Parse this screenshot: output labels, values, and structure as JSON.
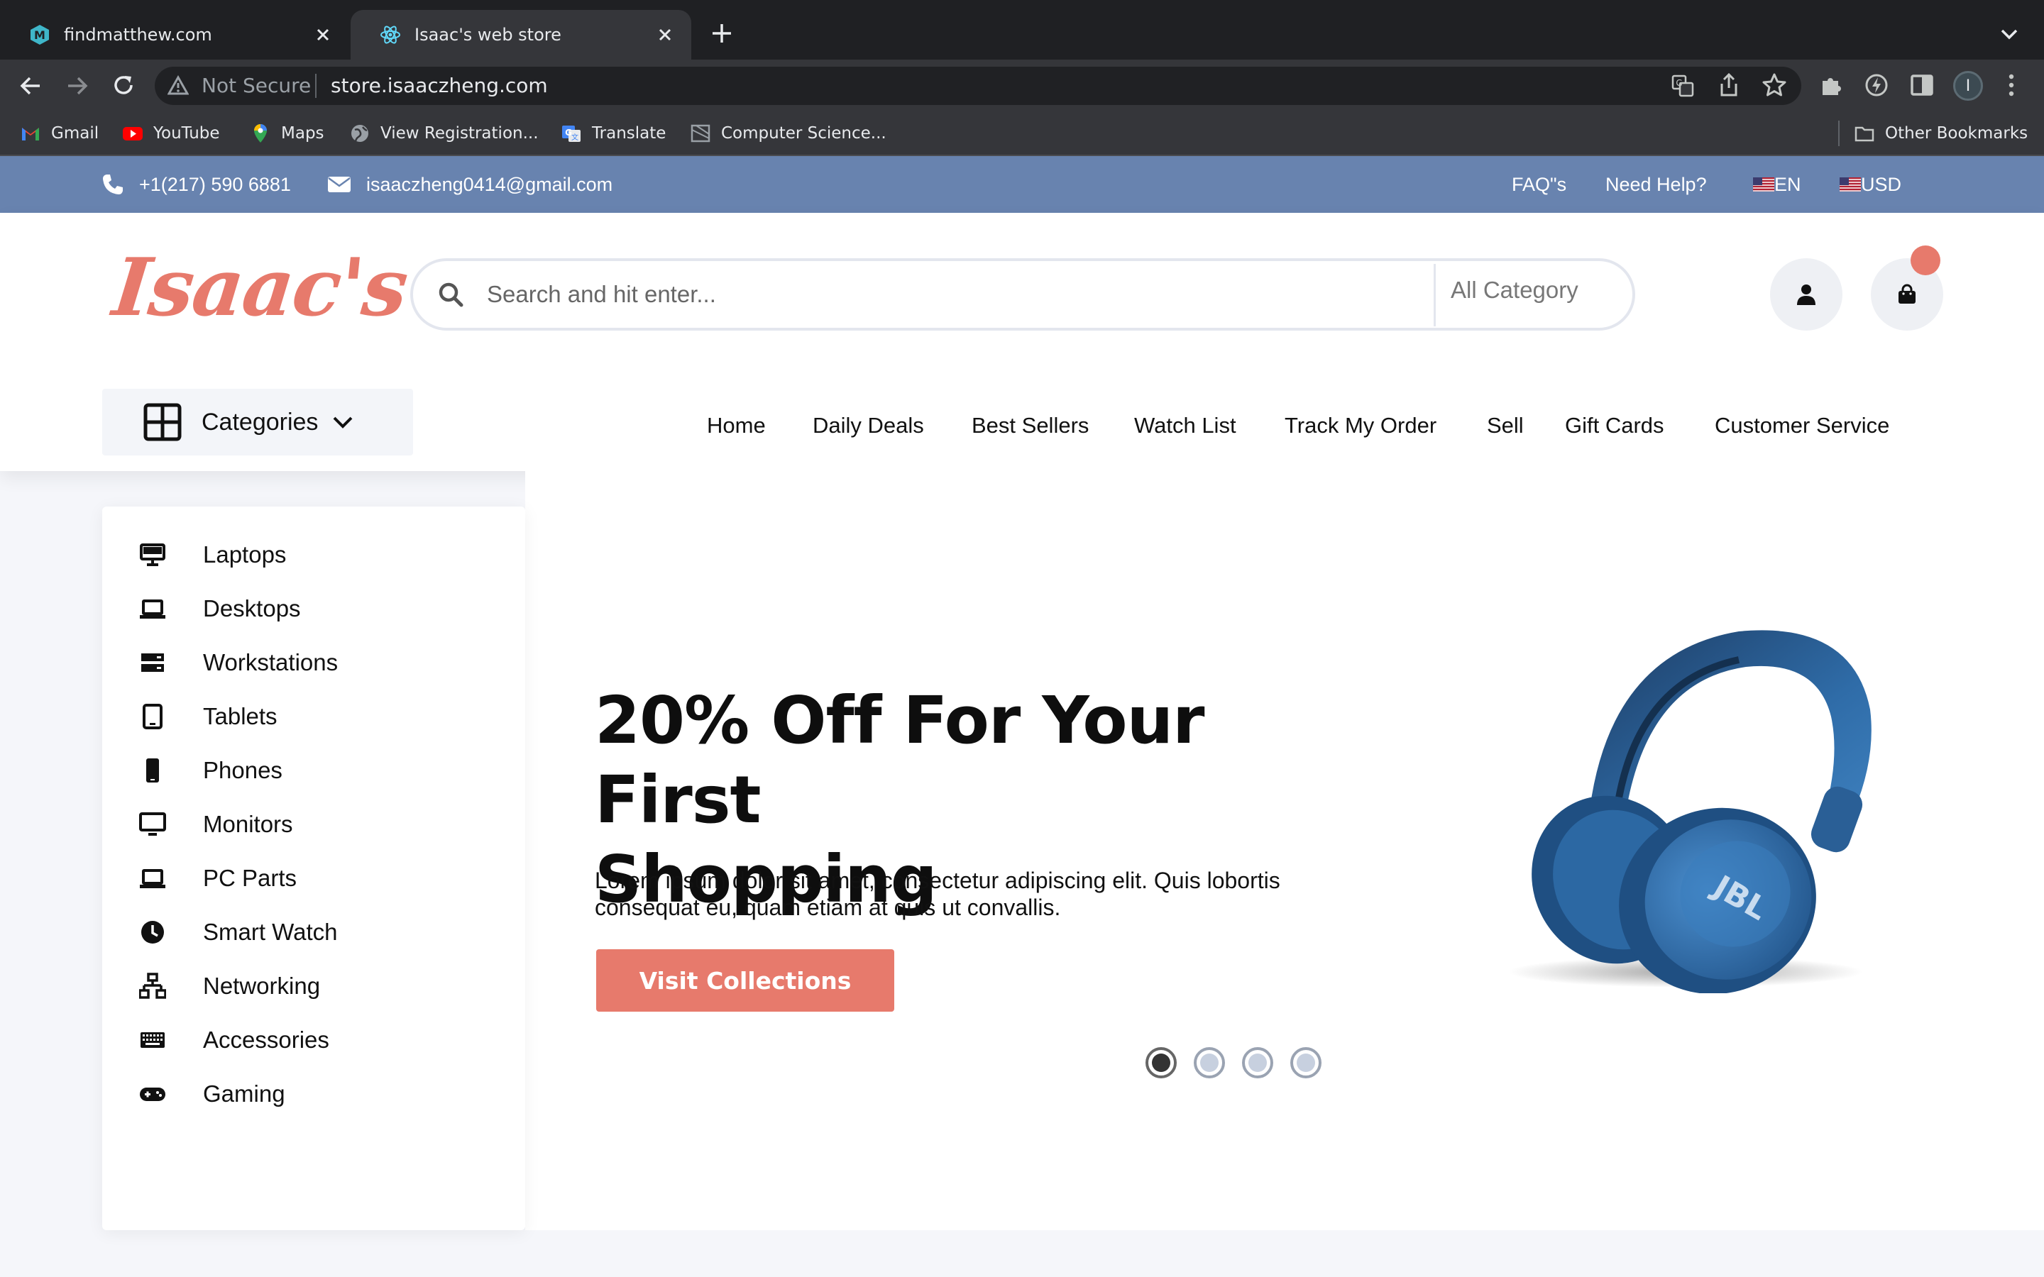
{
  "browser": {
    "tabs": [
      {
        "title": "findmatthew.com",
        "active": false
      },
      {
        "title": "Isaac's web store",
        "active": true
      }
    ],
    "security_label": "Not Secure",
    "url": "store.isaaczheng.com",
    "profile_initial": "I",
    "bookmarks": [
      "Gmail",
      "YouTube",
      "Maps",
      "View Registration...",
      "Translate",
      "Computer Science..."
    ],
    "other_bookmarks": "Other Bookmarks"
  },
  "topbar": {
    "phone": "+1(217) 590 6881",
    "email": "isaaczheng0414@gmail.com",
    "faq": "FAQ\"s",
    "help": "Need Help?",
    "language": "EN",
    "currency": "USD"
  },
  "header": {
    "logo": "Isaac's",
    "search_placeholder": "Search and hit enter...",
    "category_select": "All Category",
    "categories_button": "Categories"
  },
  "nav": [
    "Home",
    "Daily Deals",
    "Best Sellers",
    "Watch List",
    "Track My Order",
    "Sell",
    "Gift Cards",
    "Customer Service"
  ],
  "sidebar": {
    "items": [
      {
        "label": "Laptops",
        "icon": "desktop-icon"
      },
      {
        "label": "Desktops",
        "icon": "laptop-icon"
      },
      {
        "label": "Workstations",
        "icon": "server-icon"
      },
      {
        "label": "Tablets",
        "icon": "tablet-icon"
      },
      {
        "label": "Phones",
        "icon": "phone-icon"
      },
      {
        "label": "Monitors",
        "icon": "monitor-icon"
      },
      {
        "label": "PC Parts",
        "icon": "laptop-icon"
      },
      {
        "label": "Smart Watch",
        "icon": "clock-icon"
      },
      {
        "label": "Networking",
        "icon": "network-icon"
      },
      {
        "label": "Accessories",
        "icon": "keyboard-icon"
      },
      {
        "label": "Gaming",
        "icon": "gamepad-icon"
      }
    ]
  },
  "hero": {
    "title_line1": "20% Off For Your First",
    "title_line2": "Shopping",
    "description_line1": "Lorem ipsum dolor sit amet, consectetur adipiscing elit. Quis lobortis",
    "description_line2": "consequat eu, quam etiam at quis ut convallis.",
    "cta": "Visit Collections",
    "image_brand": "JBL",
    "slides": 4,
    "active_slide": 1
  },
  "colors": {
    "accent": "#e77a6c",
    "topbar": "#6883af",
    "chrome_dark": "#1f2023",
    "chrome_toolbar": "#35363a",
    "headphone_blue": "#2f6ca8"
  }
}
